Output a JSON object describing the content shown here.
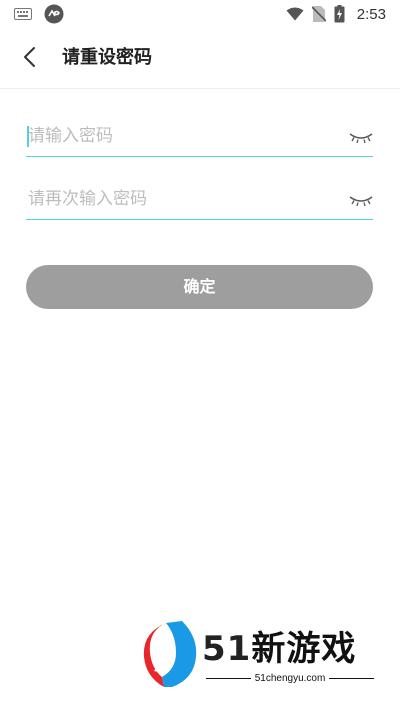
{
  "status_bar": {
    "time": "2:53",
    "icons": [
      "keyboard-icon",
      "app-notification-icon",
      "wifi-icon",
      "no-sim-icon",
      "battery-charging-icon"
    ]
  },
  "header": {
    "back_icon": "chevron-left-icon",
    "title": "请重设密码"
  },
  "form": {
    "password": {
      "placeholder": "请输入密码",
      "value": ""
    },
    "confirm_password": {
      "placeholder": "请再次输入密码",
      "value": ""
    },
    "toggle_icon": "eye-closed-icon",
    "accent_color": "#4fd3e3",
    "submit_label": "确定",
    "submit_color": "#9e9e9e"
  },
  "watermark": {
    "number": "51",
    "name": "新游戏",
    "url": "51chengyu.com"
  }
}
